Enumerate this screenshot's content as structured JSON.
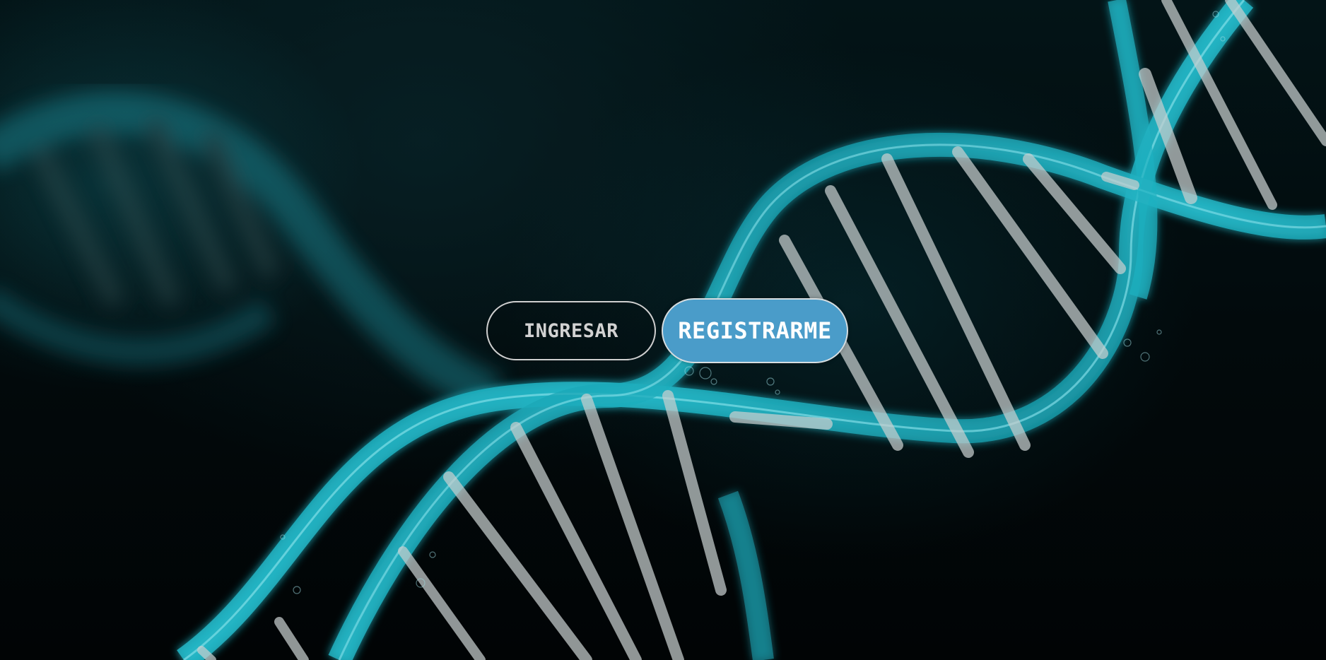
{
  "page": {
    "background_art": "dna-double-helix-illustration"
  },
  "actions": {
    "login_label": "INGRESAR",
    "register_label": "REGISTRARME"
  },
  "colors": {
    "background": "#020607",
    "helix": "#19a3b3",
    "rungs": "#c9cfcf",
    "register_button": "#4a9cc9",
    "login_border": "#cfcfcf"
  }
}
